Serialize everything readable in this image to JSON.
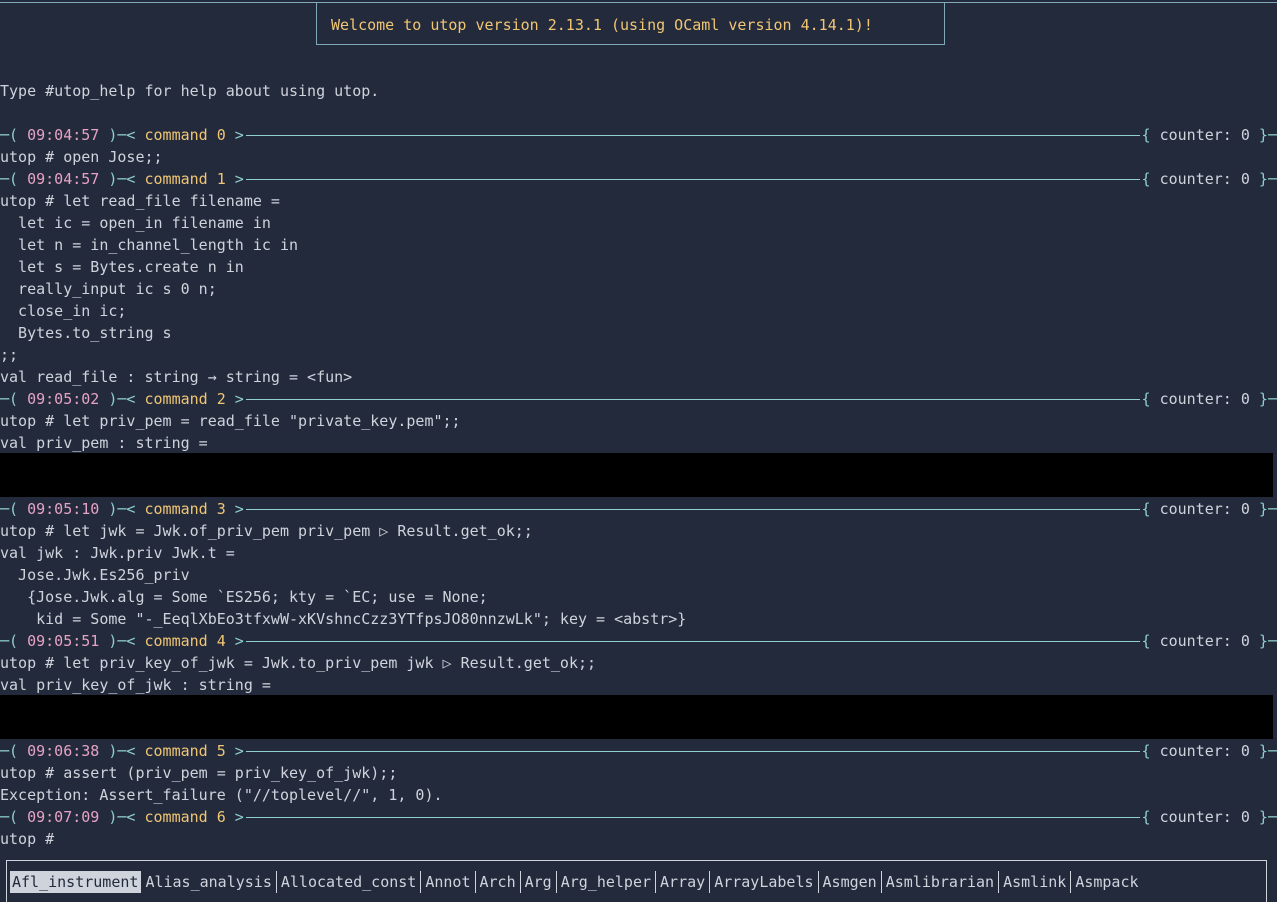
{
  "banner": "Welcome to utop version 2.13.1 (using OCaml version 4.14.1)!",
  "help_line": "Type #utop_help for help about using utop.",
  "prompts": [
    {
      "time": "09:04:57",
      "command": "command 0",
      "counter": "counter: 0"
    },
    {
      "time": "09:04:57",
      "command": "command 1",
      "counter": "counter: 0"
    },
    {
      "time": "09:05:02",
      "command": "command 2",
      "counter": "counter: 0"
    },
    {
      "time": "09:05:10",
      "command": "command 3",
      "counter": "counter: 0"
    },
    {
      "time": "09:05:51",
      "command": "command 4",
      "counter": "counter: 0"
    },
    {
      "time": "09:06:38",
      "command": "command 5",
      "counter": "counter: 0"
    },
    {
      "time": "09:07:09",
      "command": "command 6",
      "counter": "counter: 0"
    }
  ],
  "lines": [
    "utop # open Jose;;",
    "utop # let read_file filename =",
    "  let ic = open_in filename in",
    "  let n = in_channel_length ic in",
    "  let s = Bytes.create n in",
    "  really_input ic s 0 n;",
    "  close_in ic;",
    "  Bytes.to_string s",
    ";;",
    "val read_file : string → string = <fun>",
    "utop # let priv_pem = read_file \"private_key.pem\";;",
    "val priv_pem : string =",
    "utop # let jwk = Jwk.of_priv_pem priv_pem ▷ Result.get_ok;;",
    "val jwk : Jwk.priv Jwk.t =",
    "  Jose.Jwk.Es256_priv",
    "   {Jose.Jwk.alg = Some `ES256; kty = `EC; use = None;",
    "    kid = Some \"-_EeqlXbEo3tfxwW-xKVshncCzz3YTfpsJO80nnzwLk\"; key = <abstr>}",
    "utop # let priv_key_of_jwk = Jwk.to_priv_pem jwk ▷ Result.get_ok;;",
    "val priv_key_of_jwk : string =",
    "utop # assert (priv_pem = priv_key_of_jwk);;",
    "Exception: Assert_failure (\"//toplevel//\", 1, 0).",
    "utop # "
  ],
  "completions": [
    "Afl_instrument",
    "Alias_analysis",
    "Allocated_const",
    "Annot",
    "Arch",
    "Arg",
    "Arg_helper",
    "Array",
    "ArrayLabels",
    "Asmgen",
    "Asmlibrarian",
    "Asmlink",
    "Asmpack"
  ]
}
